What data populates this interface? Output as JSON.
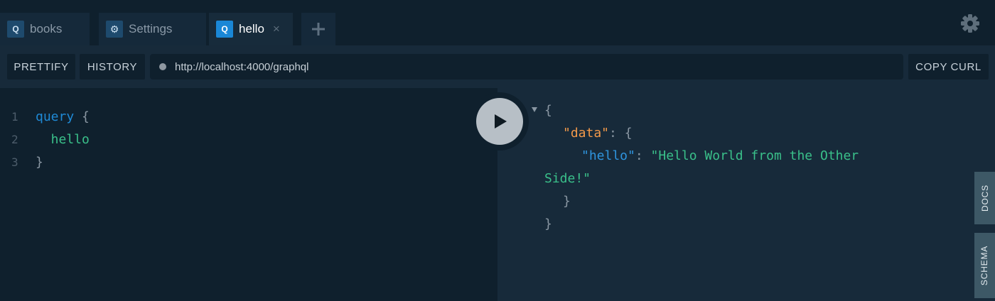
{
  "tabs": [
    {
      "badge": "Q",
      "label": "books",
      "active": false
    },
    {
      "badge": "⚙",
      "label": "Settings",
      "active": false
    },
    {
      "badge": "Q",
      "label": "hello",
      "active": true,
      "close": "×"
    }
  ],
  "new_tab_icon": "plus-icon",
  "settings_icon": "gear-icon",
  "toolbar": {
    "prettify_label": "PRETTIFY",
    "history_label": "HISTORY",
    "endpoint_url": "http://localhost:4000/graphql",
    "copy_curl_label": "COPY CURL"
  },
  "editor": {
    "lines": [
      {
        "number": "1",
        "keyword": "query",
        "rest": " {"
      },
      {
        "number": "2",
        "field": "  hello"
      },
      {
        "number": "3",
        "rest": "}"
      }
    ]
  },
  "result": {
    "open_brace": "{",
    "data_key": "\"data\"",
    "colon": ": ",
    "inner_open": "{",
    "hello_key": "\"hello\"",
    "hello_value_part1": "\"Hello World from the Other",
    "hello_value_part2": "Side!\"",
    "inner_close": "}",
    "close_brace": "}"
  },
  "run_button_icon": "play-icon",
  "side_tabs": {
    "docs_label": "DOCS",
    "schema_label": "SCHEMA"
  },
  "colors": {
    "accent": "#1a87d6",
    "keyword": "#1f8ad6",
    "string": "#3ac08a",
    "data_key": "#f2994a"
  }
}
